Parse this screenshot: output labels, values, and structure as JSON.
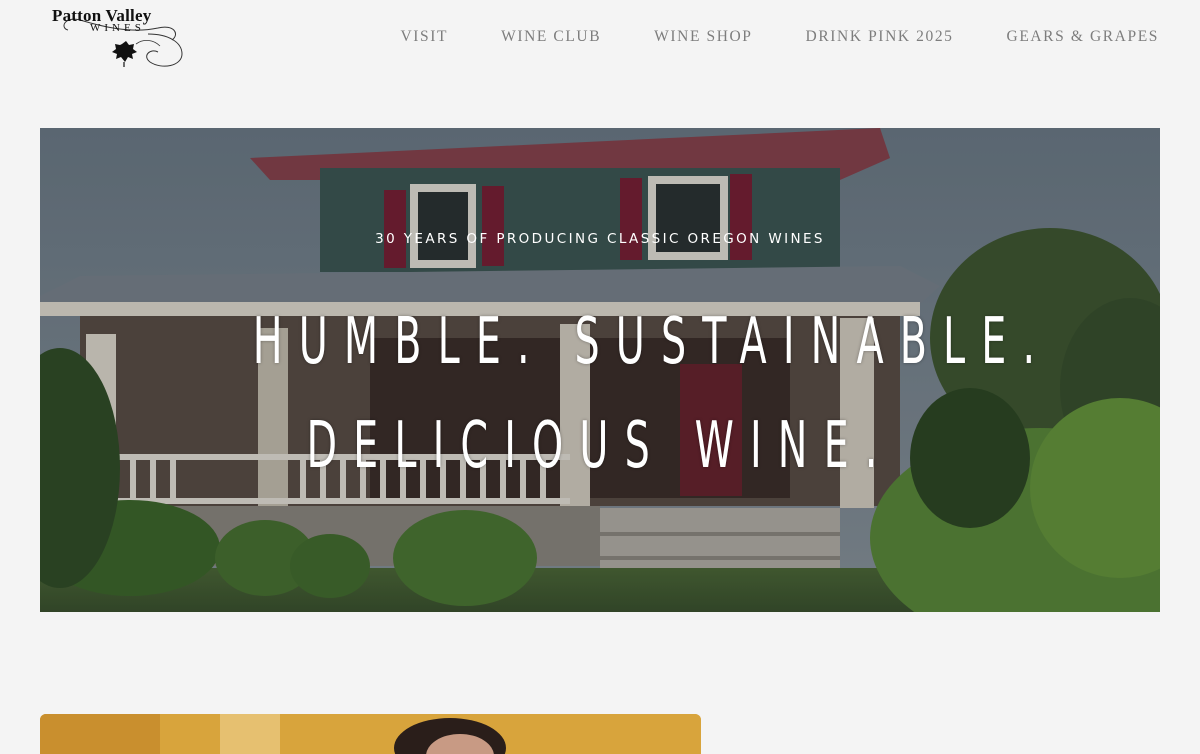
{
  "brand": {
    "name": "Patton Valley",
    "sub": "WINES"
  },
  "nav": {
    "items": [
      {
        "label": "VISIT"
      },
      {
        "label": "WINE CLUB"
      },
      {
        "label": "WINE SHOP"
      },
      {
        "label": "DRINK PINK 2025"
      },
      {
        "label": "GEARS & GRAPES"
      }
    ]
  },
  "hero": {
    "tagline": "30 YEARS OF PRODUCING CLASSIC OREGON WINES",
    "headline_line1": "HUMBLE. SUSTAINABLE.",
    "headline_line2": "DELICIOUS WINE."
  },
  "colors": {
    "background": "#f4f4f4",
    "nav_text": "#7d7d7d",
    "hero_text": "#ffffff"
  },
  "icons": {
    "logo": "grape-leaf-logo"
  }
}
